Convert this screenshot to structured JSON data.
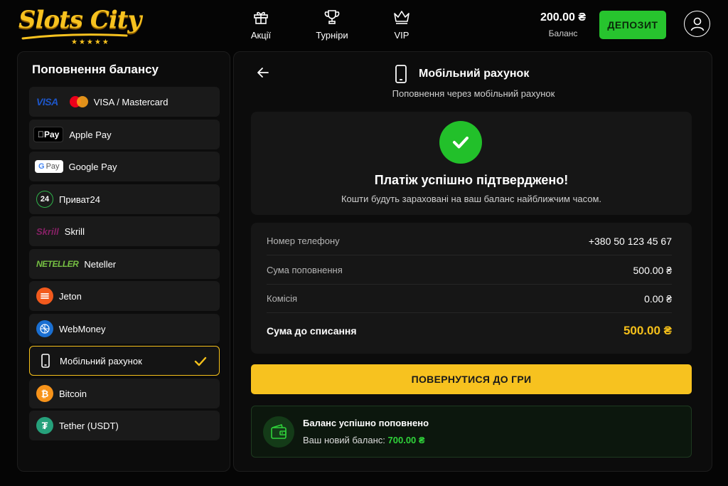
{
  "header": {
    "logo_text": "Slots City",
    "logo_stars": "★★★★★",
    "nav": [
      {
        "label": "Акції",
        "icon": "gift-icon"
      },
      {
        "label": "Турніри",
        "icon": "trophy-icon"
      },
      {
        "label": "VIP",
        "icon": "crown-icon"
      }
    ],
    "balance_amount": "200.00 ₴",
    "balance_label": "Баланс",
    "deposit_label": "ДЕПОЗИТ"
  },
  "sidebar": {
    "title": "Поповнення балансу",
    "items": [
      {
        "label": "VISA / Mastercard",
        "logo": "VISA",
        "icon": "visa-mastercard-icon"
      },
      {
        "label": "Apple Pay",
        "logo": "Pay",
        "icon": "apple-pay-icon"
      },
      {
        "label": "Google Pay",
        "logo": "Pay",
        "icon": "google-pay-icon"
      },
      {
        "label": "Приват24",
        "logo": "24",
        "icon": "privat24-icon"
      },
      {
        "label": "Skrill",
        "logo": "Skrill",
        "icon": "skrill-icon"
      },
      {
        "label": "Neteller",
        "logo": "NETELLER",
        "icon": "neteller-icon"
      },
      {
        "label": "Jeton",
        "icon": "jeton-icon"
      },
      {
        "label": "WebMoney",
        "icon": "webmoney-icon"
      },
      {
        "label": "Мобільний рахунок",
        "icon": "mobile-phone-icon",
        "active": true
      },
      {
        "label": "Bitcoin",
        "logo": "₿",
        "icon": "bitcoin-icon"
      },
      {
        "label": "Tether (USDT)",
        "logo": "₮",
        "icon": "tether-icon"
      }
    ]
  },
  "main": {
    "title": "Мобільний рахунок",
    "subtitle": "Поповнення через мобільний рахунок",
    "success_title": "Платіж успішно підтверджено!",
    "success_subtitle": "Кошти будуть зараховані на ваш баланс найближчим часом.",
    "details": [
      {
        "label": "Номер телефону",
        "value": "+380 50 123 45 67"
      },
      {
        "label": "Сума поповнення",
        "value": "500.00 ₴"
      },
      {
        "label": "Комісія",
        "value": "0.00 ₴"
      }
    ],
    "total_label": "Сума до списання",
    "total_value": "500.00 ₴",
    "return_button": "ПОВЕРНУТИСЯ ДО ГРИ",
    "balance_card": {
      "title": "Баланс успішно поповнено",
      "prefix": "Ваш новий баланс:",
      "amount": "700.00 ₴"
    }
  },
  "colors": {
    "accent_yellow": "#f7c21f",
    "accent_green": "#27c42e",
    "panel_bg": "#0c0c0c",
    "card_bg": "#161616"
  }
}
